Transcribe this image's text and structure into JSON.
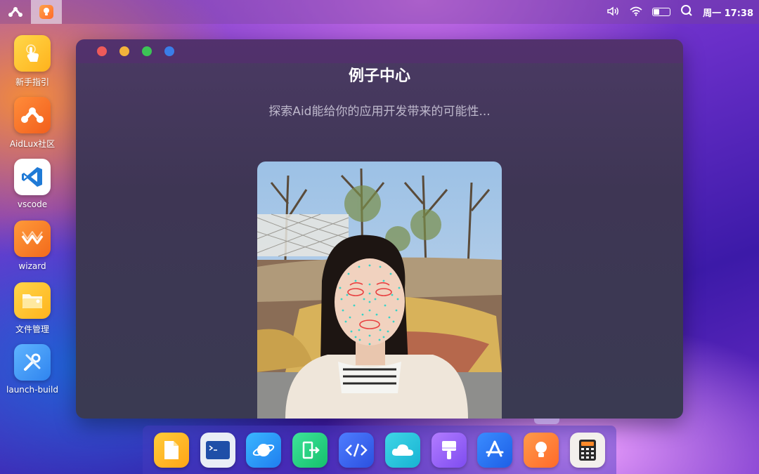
{
  "topbar": {
    "clock": "周一 17:38",
    "battery_level": 0.35
  },
  "launcher": {
    "items": [
      {
        "label": "新手指引",
        "icon": "hand-pointer-icon"
      },
      {
        "label": "AidLux社区",
        "icon": "aidlux-logo-icon"
      },
      {
        "label": "vscode",
        "icon": "vscode-icon"
      },
      {
        "label": "wizard",
        "icon": "wizard-icon"
      },
      {
        "label": "文件管理",
        "icon": "folder-icon"
      },
      {
        "label": "launch-build",
        "icon": "tools-icon"
      }
    ]
  },
  "window": {
    "title": "例子中心",
    "subtitle": "探索Aid能给你的应用开发带来的可能性..."
  },
  "dock": {
    "items": [
      "files-icon",
      "terminal-icon",
      "browser-planet-icon",
      "exit-door-icon",
      "code-editor-icon",
      "cloud-icon",
      "paint-brush-icon",
      "app-store-icon",
      "lightbulb-icon",
      "calculator-icon"
    ]
  },
  "colors": {
    "traffic_red": "#ee5a5a",
    "traffic_yellow": "#f3b33b",
    "traffic_green": "#3cc456",
    "traffic_blue": "#3a7de8"
  }
}
